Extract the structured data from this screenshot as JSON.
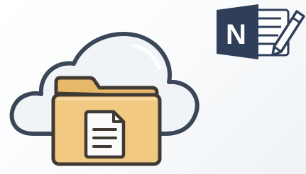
{
  "image": {
    "description_icons": [
      "cloud-icon",
      "folder-icon",
      "document-icon",
      "onenote-icon",
      "pen-icon"
    ]
  },
  "onenote": {
    "letter": "N",
    "brand_color": "#2f3f5a"
  },
  "colors": {
    "background": "#f7f9fb",
    "cloud_fill": "#f1f4f7",
    "cloud_stroke": "#3b4758",
    "folder_fill": "#f1c983",
    "folder_back": "#e8b86a",
    "folder_stroke": "#3f3a33",
    "document_fill": "#fbfbfb"
  }
}
